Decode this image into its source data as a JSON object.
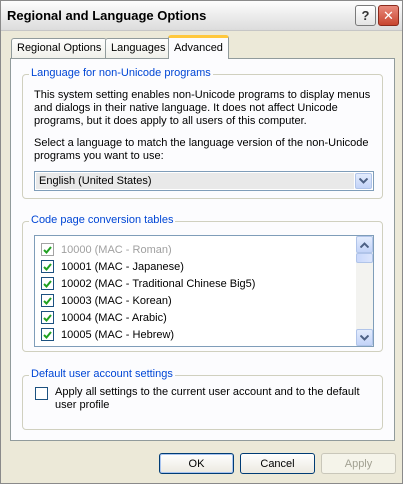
{
  "window": {
    "title": "Regional and Language Options",
    "help_glyph": "?",
    "close_glyph": "✕"
  },
  "tabs": [
    {
      "label": "Regional Options",
      "active": false
    },
    {
      "label": "Languages",
      "active": false
    },
    {
      "label": "Advanced",
      "active": true
    }
  ],
  "non_unicode": {
    "legend": "Language for non-Unicode programs",
    "description_lines": [
      "This system setting enables non-Unicode programs to display menus",
      "and dialogs in their native language. It does not affect Unicode",
      "programs, but it does apply to all users of this computer."
    ],
    "prompt_lines": [
      "Select a language to match the language version of the non-Unicode",
      "programs you want to use:"
    ],
    "selected_language": "English (United States)"
  },
  "code_pages": {
    "legend": "Code page conversion tables",
    "items": [
      {
        "label": "10000 (MAC - Roman)",
        "checked": true,
        "disabled": true
      },
      {
        "label": "10001 (MAC - Japanese)",
        "checked": true,
        "disabled": false
      },
      {
        "label": "10002 (MAC - Traditional Chinese Big5)",
        "checked": true,
        "disabled": false
      },
      {
        "label": "10003 (MAC - Korean)",
        "checked": true,
        "disabled": false
      },
      {
        "label": "10004 (MAC - Arabic)",
        "checked": true,
        "disabled": false
      },
      {
        "label": "10005 (MAC - Hebrew)",
        "checked": true,
        "disabled": false
      }
    ]
  },
  "default_user": {
    "legend": "Default user account settings",
    "checkbox_lines": [
      "Apply all settings to the current user account and to the default",
      "user profile"
    ],
    "checked": false
  },
  "buttons": {
    "ok": "OK",
    "cancel": "Cancel",
    "apply": "Apply"
  },
  "colors": {
    "legend_text": "#0046d5",
    "check_mark": "#21a121",
    "active_tab_accent": "#ffc83c"
  }
}
